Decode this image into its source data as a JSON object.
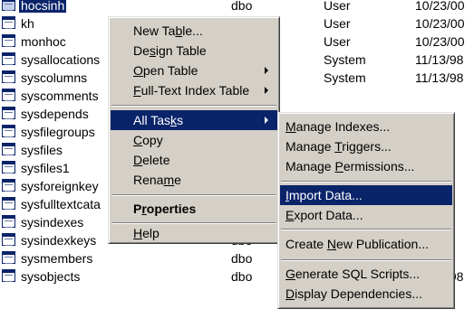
{
  "rows": [
    {
      "name": "hocsinh",
      "owner": "dbo",
      "type": "User",
      "date": "10/23/00"
    },
    {
      "name": "kh",
      "owner": "",
      "type": "User",
      "date": "10/23/00"
    },
    {
      "name": "monhoc",
      "owner": "",
      "type": "User",
      "date": "10/23/00"
    },
    {
      "name": "sysallocations",
      "owner": "",
      "type": "System",
      "date": "11/13/98"
    },
    {
      "name": "syscolumns",
      "owner": "",
      "type": "System",
      "date": "11/13/98"
    },
    {
      "name": "syscomments",
      "owner": "",
      "type": "",
      "date": ""
    },
    {
      "name": "sysdepends",
      "owner": "",
      "type": "",
      "date": ""
    },
    {
      "name": "sysfilegroups",
      "owner": "",
      "type": "",
      "date": ""
    },
    {
      "name": "sysfiles",
      "owner": "",
      "type": "",
      "date": ""
    },
    {
      "name": "sysfiles1",
      "owner": "",
      "type": "",
      "date": ""
    },
    {
      "name": "sysforeignkey",
      "owner": "",
      "type": "",
      "date": ""
    },
    {
      "name": "sysfulltextcata",
      "owner": "",
      "type": "",
      "date": ""
    },
    {
      "name": "sysindexes",
      "owner": "dbo",
      "type": "",
      "date": ""
    },
    {
      "name": "sysindexkeys",
      "owner": "dbo",
      "type": "",
      "date": ""
    },
    {
      "name": "sysmembers",
      "owner": "dbo",
      "type": "",
      "date": ""
    },
    {
      "name": "sysobjects",
      "owner": "dbo",
      "type": "System",
      "date": "11/13/98"
    }
  ],
  "context_menu": {
    "new_table": {
      "pre": "New Ta",
      "key": "b",
      "post": "le..."
    },
    "design_table": {
      "pre": "De",
      "key": "s",
      "post": "ign Table"
    },
    "open_table": {
      "pre": "",
      "key": "O",
      "post": "pen Table"
    },
    "full_text_index": {
      "pre": "",
      "key": "F",
      "post": "ull-Text Index Table"
    },
    "all_tasks": {
      "pre": "All Tas",
      "key": "k",
      "post": "s"
    },
    "copy": {
      "pre": "",
      "key": "C",
      "post": "opy"
    },
    "delete": {
      "pre": "",
      "key": "D",
      "post": "elete"
    },
    "rename": {
      "pre": "Rena",
      "key": "m",
      "post": "e"
    },
    "properties": {
      "pre": "P",
      "key": "r",
      "post": "operties"
    },
    "help": {
      "pre": "",
      "key": "H",
      "post": "elp"
    }
  },
  "submenu": {
    "manage_indexes": {
      "pre": "",
      "key": "M",
      "post": "anage Indexes..."
    },
    "manage_triggers": {
      "pre": "Manage ",
      "key": "T",
      "post": "riggers..."
    },
    "manage_permissions": {
      "pre": "Manage ",
      "key": "P",
      "post": "ermissions..."
    },
    "import_data": {
      "pre": "",
      "key": "I",
      "post": "mport Data..."
    },
    "export_data": {
      "pre": "",
      "key": "E",
      "post": "xport Data..."
    },
    "create_publication": {
      "pre": "Create ",
      "key": "N",
      "post": "ew Publication..."
    },
    "generate_scripts": {
      "pre": "",
      "key": "G",
      "post": "enerate SQL Scripts..."
    },
    "display_dependencies": {
      "pre": "",
      "key": "D",
      "post": "isplay Dependencies..."
    }
  },
  "colors": {
    "highlight": "#0a246a",
    "menu_face": "#d4d0c8"
  }
}
